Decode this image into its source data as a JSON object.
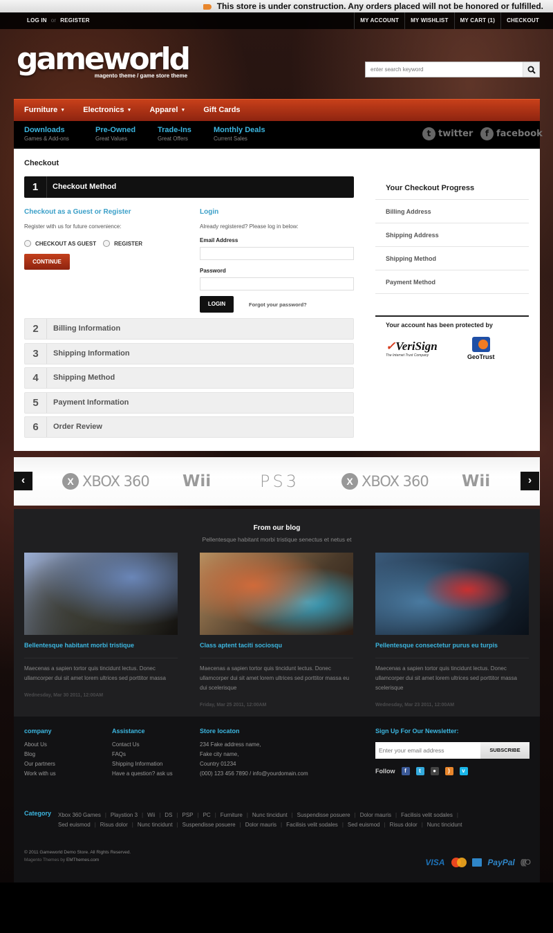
{
  "notice": "This store is under construction. Any orders placed will not be honored or fulfilled.",
  "topbar": {
    "login": "LOG IN",
    "or": "or",
    "register": "REGISTER",
    "links": [
      "MY ACCOUNT",
      "MY WISHLIST",
      "MY CART (1)",
      "CHECKOUT"
    ]
  },
  "header": {
    "logo": "gameworld",
    "tagline": "magento theme / game store theme",
    "search_placeholder": "enter search keyword"
  },
  "nav": {
    "items": [
      {
        "label": "Furniture",
        "dropdown": true
      },
      {
        "label": "Electronics",
        "dropdown": true
      },
      {
        "label": "Apparel",
        "dropdown": true
      },
      {
        "label": "Gift Cards",
        "dropdown": false
      }
    ],
    "subitems": [
      {
        "title": "Downloads",
        "desc": "Games & Add-ons"
      },
      {
        "title": "Pre-Owned",
        "desc": "Great Values"
      },
      {
        "title": "Trade-Ins",
        "desc": "Great Offers"
      },
      {
        "title": "Monthly Deals",
        "desc": "Current Sales"
      }
    ],
    "social": {
      "twitter": "twitter",
      "facebook": "facebook"
    }
  },
  "checkout": {
    "page_title": "Checkout",
    "active_step": {
      "num": "1",
      "label": "Checkout Method"
    },
    "guest": {
      "heading": "Checkout as a Guest or Register",
      "hint": "Register with us for future convenience:",
      "opt_guest": "CHECKOUT AS GUEST",
      "opt_register": "REGISTER",
      "continue": "CONTINUE"
    },
    "login": {
      "heading": "Login",
      "hint": "Already registered? Please log in below:",
      "email_label": "Email Address",
      "password_label": "Password",
      "login_button": "LOGIN",
      "forgot": "Forgot your password?"
    },
    "steps": [
      {
        "num": "2",
        "label": "Billing Information"
      },
      {
        "num": "3",
        "label": "Shipping Information"
      },
      {
        "num": "4",
        "label": "Shipping Method"
      },
      {
        "num": "5",
        "label": "Payment Information"
      },
      {
        "num": "6",
        "label": "Order Review"
      }
    ],
    "progress": {
      "heading": "Your Checkout Progress",
      "items": [
        "Billing Address",
        "Shipping Address",
        "Shipping Method",
        "Payment Method"
      ]
    },
    "protection": {
      "heading": "Your account has been protected by",
      "verisign": "VeriSign",
      "verisign_tag": "The Internet Trust Company",
      "geotrust": "GeoTrust"
    }
  },
  "brands": {
    "prev": "‹",
    "next": "›",
    "list": [
      {
        "name": "XBOX 360",
        "kind": "xbox"
      },
      {
        "name": "Wii",
        "kind": "wii"
      },
      {
        "name": "PS3",
        "kind": "ps3"
      },
      {
        "name": "XBOX 360",
        "kind": "xbox"
      },
      {
        "name": "Wii",
        "kind": "wii"
      }
    ]
  },
  "blog": {
    "title": "From our blog",
    "tagline": "Pellentesque habitant morbi tristique senectus et netus et",
    "posts": [
      {
        "title": "Bellentesque habitant morbi tristique",
        "body": "Maecenas a sapien tortor quis tincidunt lectus. Donec ullamcorper dui sit amet lorem ultrices sed porttitor massa",
        "date": "Wednesday, Mar 30 2011, 12:00AM"
      },
      {
        "title": "Class aptent taciti sociosqu",
        "body": "Maecenas a sapien tortor quis tincidunt lectus. Donec ullamcorper dui sit amet lorem ultrices sed porttitor massa eu dui scelerisque",
        "date": "Friday, Mar 25 2011, 12:00AM"
      },
      {
        "title": "Pellentesque consectetur purus eu turpis",
        "body": "Maecenas a sapien tortor quis tincidunt lectus. Donec ullamcorper dui sit amet lorem ultrices sed porttitor massa scelerisque",
        "date": "Wednesday, Mar 23 2011, 12:00AM"
      }
    ]
  },
  "footer": {
    "company": {
      "heading": "company",
      "links": [
        "About Us",
        "Blog",
        "Our partners",
        "Work with us"
      ]
    },
    "assistance": {
      "heading": "Assistance",
      "links": [
        "Contact Us",
        "FAQs",
        "Shipping Information",
        "Have a question? ask us"
      ]
    },
    "store": {
      "heading": "Store locaton",
      "lines": [
        "234 Fake address name,",
        "Fake city name,",
        "Country 01234",
        "(000) 123 456 7890 / info@yourdomain.com"
      ]
    },
    "newsletter": {
      "heading": "Sign Up For Our Newsletter:",
      "placeholder": "Enter your email address",
      "button": "SUBSCRIBE",
      "follow": "Follow"
    },
    "category": {
      "heading": "Category",
      "tags": [
        "Xbox 360 Games",
        "Playstion 3",
        "Wii",
        "DS",
        "PSP",
        "PC",
        "Furniture",
        "Nunc tincidunt",
        "Suspendisse posuere",
        "Dolor mauris",
        "Facilisis velit sodales",
        "Sed euismod",
        "Risus dolor",
        "Nunc tincidunt",
        "Suspendisse posuere",
        "Dolor mauris",
        "Facilisis velit sodales",
        "Sed euismod",
        "Risus dolor",
        "Nunc tincidunt"
      ]
    },
    "copyright": "© 2011 Gameworld Demo Store. All Rights Reserved.",
    "credit_prefix": "Magento Themes",
    "credit_by": "by",
    "credit_name": "EMThemes.com",
    "payments": {
      "visa": "VISA",
      "paypal": "PayPal"
    }
  }
}
